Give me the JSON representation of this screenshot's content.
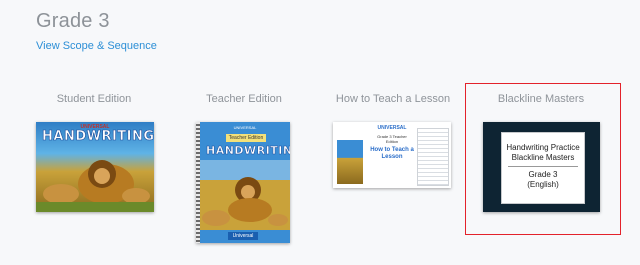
{
  "page": {
    "title": "Grade 3",
    "scope_link": "View Scope & Sequence"
  },
  "cards": [
    {
      "label": "Student Edition",
      "cover_word": "HANDWRITING",
      "cover_tag": "UNIVERSAL"
    },
    {
      "label": "Teacher Edition",
      "cover_word": "HANDWRITING",
      "cover_tag": "UNIVERSAL",
      "banner": "Teacher Edition",
      "footer": "Universal"
    },
    {
      "label": "How to Teach a Lesson",
      "cover_title": "How to Teach a Lesson",
      "cover_tag": "UNIVERSAL",
      "cover_sub": "Grade 3 Teacher Edition"
    },
    {
      "label": "Blackline Masters",
      "line1": "Handwriting Practice",
      "line2": "Blackline Masters",
      "line3": "Grade 3",
      "line4": "(English)"
    }
  ],
  "colors": {
    "link": "#2d8fd6",
    "highlight": "#e3222b",
    "blm_frame": "#0e2433"
  }
}
